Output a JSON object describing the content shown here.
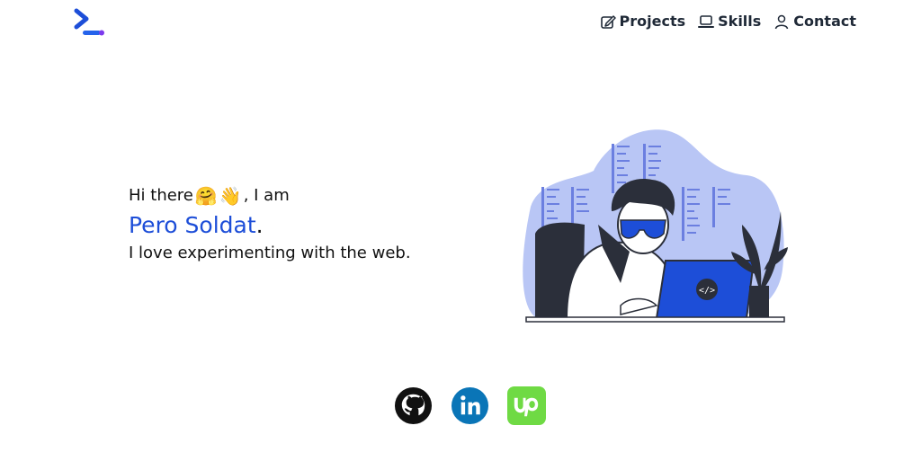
{
  "brand": {
    "logo_icon": "chevron-terminal-logo",
    "accent": "#1d4ed8",
    "accent_secondary": "#7c3aed"
  },
  "nav": [
    {
      "label": "Projects",
      "icon": "edit-icon"
    },
    {
      "label": "Skills",
      "icon": "laptop-icon"
    },
    {
      "label": "Contact",
      "icon": "user-icon"
    }
  ],
  "hero": {
    "greeting": "Hi there",
    "emoji_1": "🤗",
    "emoji_2": "👋",
    "greeting_tail": ", I am",
    "name": "Pero Soldat",
    "name_period": ".",
    "tagline": "I love experimenting with the web."
  },
  "socials": [
    {
      "name": "github",
      "icon": "github-icon"
    },
    {
      "name": "linkedin",
      "icon": "linkedin-icon"
    },
    {
      "name": "upwork",
      "icon": "upwork-icon"
    }
  ]
}
